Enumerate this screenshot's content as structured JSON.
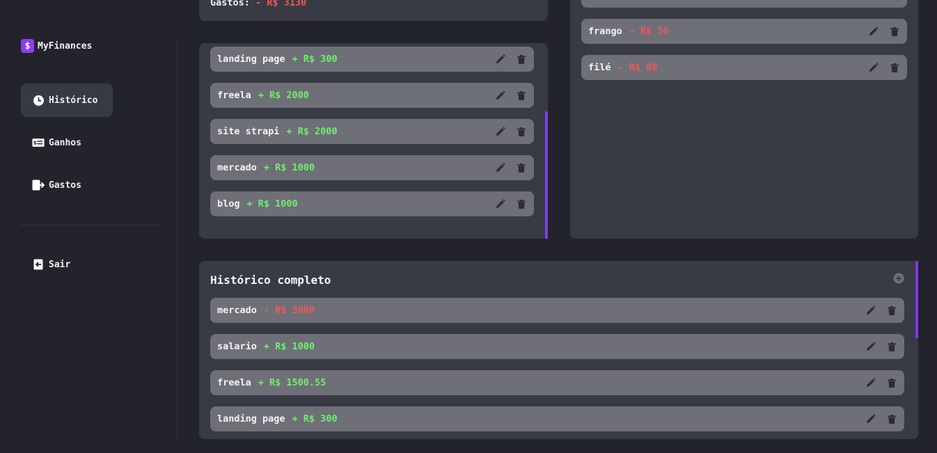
{
  "brand": {
    "name": "MyFinances",
    "logo_symbol": "$",
    "logo_color": "#8a3ff0"
  },
  "nav": [
    {
      "label": "Histórico",
      "icon": "history-icon",
      "active": true
    },
    {
      "label": "Ganhos",
      "icon": "money-icon",
      "active": false
    },
    {
      "label": "Gastos",
      "icon": "exit-icon",
      "active": false
    },
    {
      "label": "Sair",
      "icon": "logout-icon",
      "active": false
    }
  ],
  "gastos_summary": {
    "label": "Gastos:",
    "value": "- R$ 3130"
  },
  "ganhos_list": [
    {
      "desc": "landing page",
      "amount": "+ R$ 300"
    },
    {
      "desc": "freela",
      "amount": "+ R$ 2000"
    },
    {
      "desc": "site strapi",
      "amount": "+ R$ 2000"
    },
    {
      "desc": "mercado",
      "amount": "+ R$ 1000"
    },
    {
      "desc": "blog",
      "amount": "+ R$ 1000"
    }
  ],
  "gastos_list": [
    {
      "desc": "frango",
      "amount": "- R$ 50"
    },
    {
      "desc": "filé",
      "amount": "- R$ 80"
    }
  ],
  "historico": {
    "title": "Histórico completo",
    "items": [
      {
        "desc": "mercado",
        "amount": "- R$ 3000",
        "type": "neg"
      },
      {
        "desc": "salario",
        "amount": "+ R$ 1000",
        "type": "pos"
      },
      {
        "desc": "freela",
        "amount": "+ R$ 1500.55",
        "type": "pos"
      },
      {
        "desc": "landing page",
        "amount": "+ R$ 300",
        "type": "pos"
      }
    ]
  },
  "colors": {
    "accent": "#7d3ce6",
    "positive": "#6ef06b",
    "negative": "#f25757"
  }
}
